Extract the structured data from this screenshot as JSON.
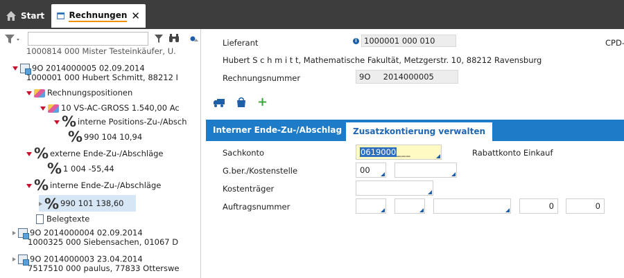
{
  "tabs": {
    "start_label": "Start",
    "active_label": "Rechnungen",
    "close_glyph": "✕"
  },
  "left": {
    "filter_placeholder": "",
    "tree": [
      {
        "text": "1000814 000 Mister Testeinkäufer, U."
      },
      {
        "line1": "9O 2014000005 02.09.2014",
        "line2": "1000001 000 Hubert Schmitt, 88212 I"
      },
      {
        "text": "Rechnungspositionen"
      },
      {
        "text": "10  VS-AC-GROSS  1.540,00  Ac"
      },
      {
        "text": "interne Positions-Zu-/Absch"
      },
      {
        "text": "990  104  10,94"
      },
      {
        "text": "externe Ende-Zu-/Abschläge"
      },
      {
        "text": "1  004  -55,44"
      },
      {
        "text": "interne Ende-Zu-/Abschläge"
      },
      {
        "text": "990  101  138,60"
      },
      {
        "text": "Belegtexte"
      },
      {
        "line1": "9O 2014000004 02.09.2014",
        "line2": "1000325 000 Siebensachen, 01067 D"
      },
      {
        "line1": "9O 2014000003 23.04.2014",
        "line2": "7517510 000 paulus, 77833 Otterswe"
      }
    ]
  },
  "right": {
    "lieferant_label": "Lieferant",
    "lieferant_info": "i",
    "lieferant_value": "1000001 000 010",
    "cpd_label": "CPD-",
    "address": "Hubert S c h m i t t, Mathematische Fakultät, Metzgerstr. 10, 88212 Ravensburg",
    "rechnungsnummer_label": "Rechnungsnummer",
    "rechnung_prefix": "9O",
    "rechnung_number": "2014000005",
    "subtabs": [
      "Interner Ende-Zu-/Abschlag",
      "Zusatzkontierung verwalten"
    ],
    "form": {
      "sachkonto_label": "Sachkonto",
      "sachkonto_value": "0619000",
      "sachkonto_desc": "Rabattkonto Einkauf",
      "gber_label": "G.ber./Kostenstelle",
      "gber_value": "00",
      "kostentraeger_label": "Kostenträger",
      "auftragsnummer_label": "Auftragsnummer",
      "auftrag_num1": "0",
      "auftrag_num2": "0"
    }
  },
  "colors": {
    "tabbar": "#3d3d3d",
    "accent_blue": "#1e7bc7",
    "accent_orange": "#f39200",
    "expand_red": "#c8102e"
  }
}
